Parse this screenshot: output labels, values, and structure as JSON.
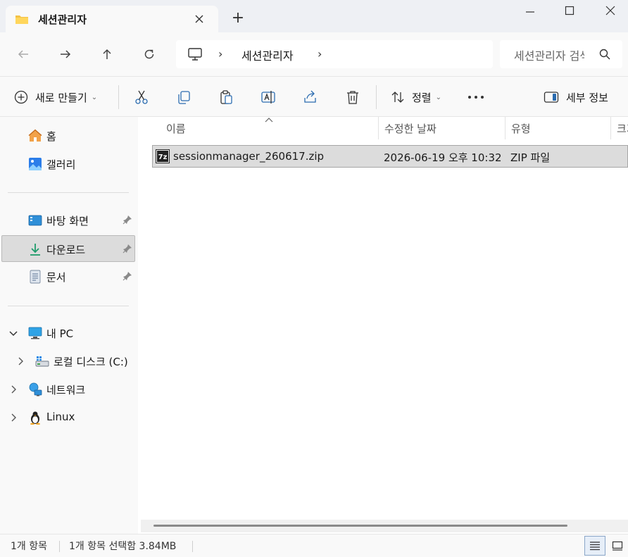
{
  "window": {
    "tab_title": "세션관리자",
    "new_tab_label": "+"
  },
  "navigation": {
    "breadcrumb": [
      "세션관리자"
    ],
    "search_placeholder": "세션관리자 검색"
  },
  "toolbar": {
    "new_label": "새로 만들기",
    "sort_label": "정렬",
    "details_label": "세부 정보"
  },
  "sidebar": {
    "quick": [
      {
        "label": "홈",
        "icon": "home-icon"
      },
      {
        "label": "갤러리",
        "icon": "gallery-icon"
      }
    ],
    "pinned": [
      {
        "label": "바탕 화면",
        "icon": "desktop-icon",
        "pinned": true
      },
      {
        "label": "다운로드",
        "icon": "download-icon",
        "pinned": true,
        "selected": true
      },
      {
        "label": "문서",
        "icon": "document-icon",
        "pinned": true
      }
    ],
    "tree": [
      {
        "label": "내 PC",
        "icon": "pc-icon",
        "expanded": true
      },
      {
        "label": "로컬 디스크 (C:)",
        "icon": "drive-icon"
      },
      {
        "label": "네트워크",
        "icon": "network-icon"
      },
      {
        "label": "Linux",
        "icon": "linux-icon"
      }
    ]
  },
  "file_list": {
    "columns": [
      "이름",
      "수정한 날짜",
      "유형",
      "크기"
    ],
    "rows": [
      {
        "name": "sessionmanager_260617.zip",
        "modified": "2026-06-19 오후 10:32",
        "type": "ZIP 파일",
        "icon": "7z-archive-icon",
        "selected": true
      }
    ]
  },
  "status": {
    "item_count": "1개 항목",
    "selection": "1개 항목 선택함 3.84MB"
  },
  "colors": {
    "accent": "#0067c0",
    "folder": "#f4c246",
    "selection": "#dcdcdc"
  }
}
